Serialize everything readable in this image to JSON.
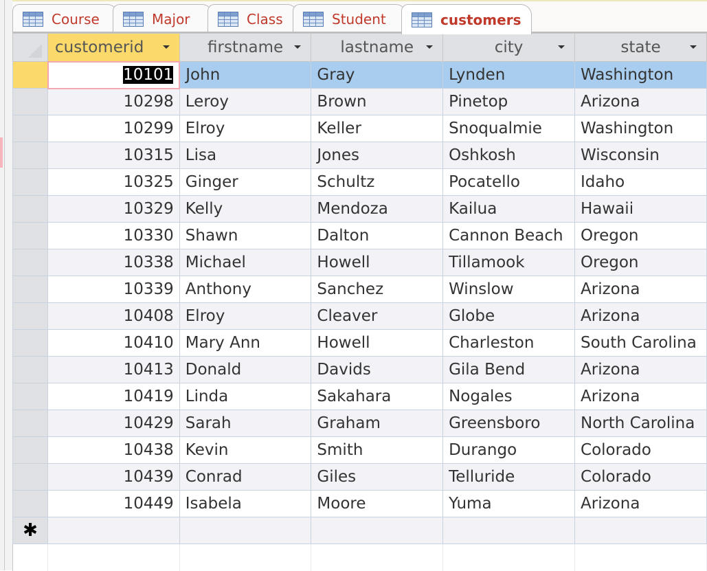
{
  "tabs": [
    {
      "label": "Course",
      "active": false,
      "icon": "table-icon"
    },
    {
      "label": "Major",
      "active": false,
      "icon": "table-icon"
    },
    {
      "label": "Class",
      "active": false,
      "icon": "table-icon"
    },
    {
      "label": "Student",
      "active": false,
      "icon": "table-icon"
    },
    {
      "label": "customers",
      "active": true,
      "icon": "table-icon"
    }
  ],
  "grid": {
    "columns": [
      "customerid",
      "firstname",
      "lastname",
      "city",
      "state"
    ],
    "sorted_column": "customerid",
    "rows": [
      [
        "10101",
        "John",
        "Gray",
        "Lynden",
        "Washington"
      ],
      [
        "10298",
        "Leroy",
        "Brown",
        "Pinetop",
        "Arizona"
      ],
      [
        "10299",
        "Elroy",
        "Keller",
        "Snoqualmie",
        "Washington"
      ],
      [
        "10315",
        "Lisa",
        "Jones",
        "Oshkosh",
        "Wisconsin"
      ],
      [
        "10325",
        "Ginger",
        "Schultz",
        "Pocatello",
        "Idaho"
      ],
      [
        "10329",
        "Kelly",
        "Mendoza",
        "Kailua",
        "Hawaii"
      ],
      [
        "10330",
        "Shawn",
        "Dalton",
        "Cannon Beach",
        "Oregon"
      ],
      [
        "10338",
        "Michael",
        "Howell",
        "Tillamook",
        "Oregon"
      ],
      [
        "10339",
        "Anthony",
        "Sanchez",
        "Winslow",
        "Arizona"
      ],
      [
        "10408",
        "Elroy",
        "Cleaver",
        "Globe",
        "Arizona"
      ],
      [
        "10410",
        "Mary Ann",
        "Howell",
        "Charleston",
        "South Carolina"
      ],
      [
        "10413",
        "Donald",
        "Davids",
        "Gila Bend",
        "Arizona"
      ],
      [
        "10419",
        "Linda",
        "Sakahara",
        "Nogales",
        "Arizona"
      ],
      [
        "10429",
        "Sarah",
        "Graham",
        "Greensboro",
        "North Carolina"
      ],
      [
        "10438",
        "Kevin",
        "Smith",
        "Durango",
        "Colorado"
      ],
      [
        "10439",
        "Conrad",
        "Giles",
        "Telluride",
        "Colorado"
      ],
      [
        "10449",
        "Isabela",
        "Moore",
        "Yuma",
        "Arizona"
      ]
    ],
    "current_row_index": 0,
    "new_record_marker": "✱"
  },
  "colors": {
    "tab_text": "#c0392b",
    "sorted_header": "#fbd96a",
    "current_row": "#a9cdee"
  }
}
